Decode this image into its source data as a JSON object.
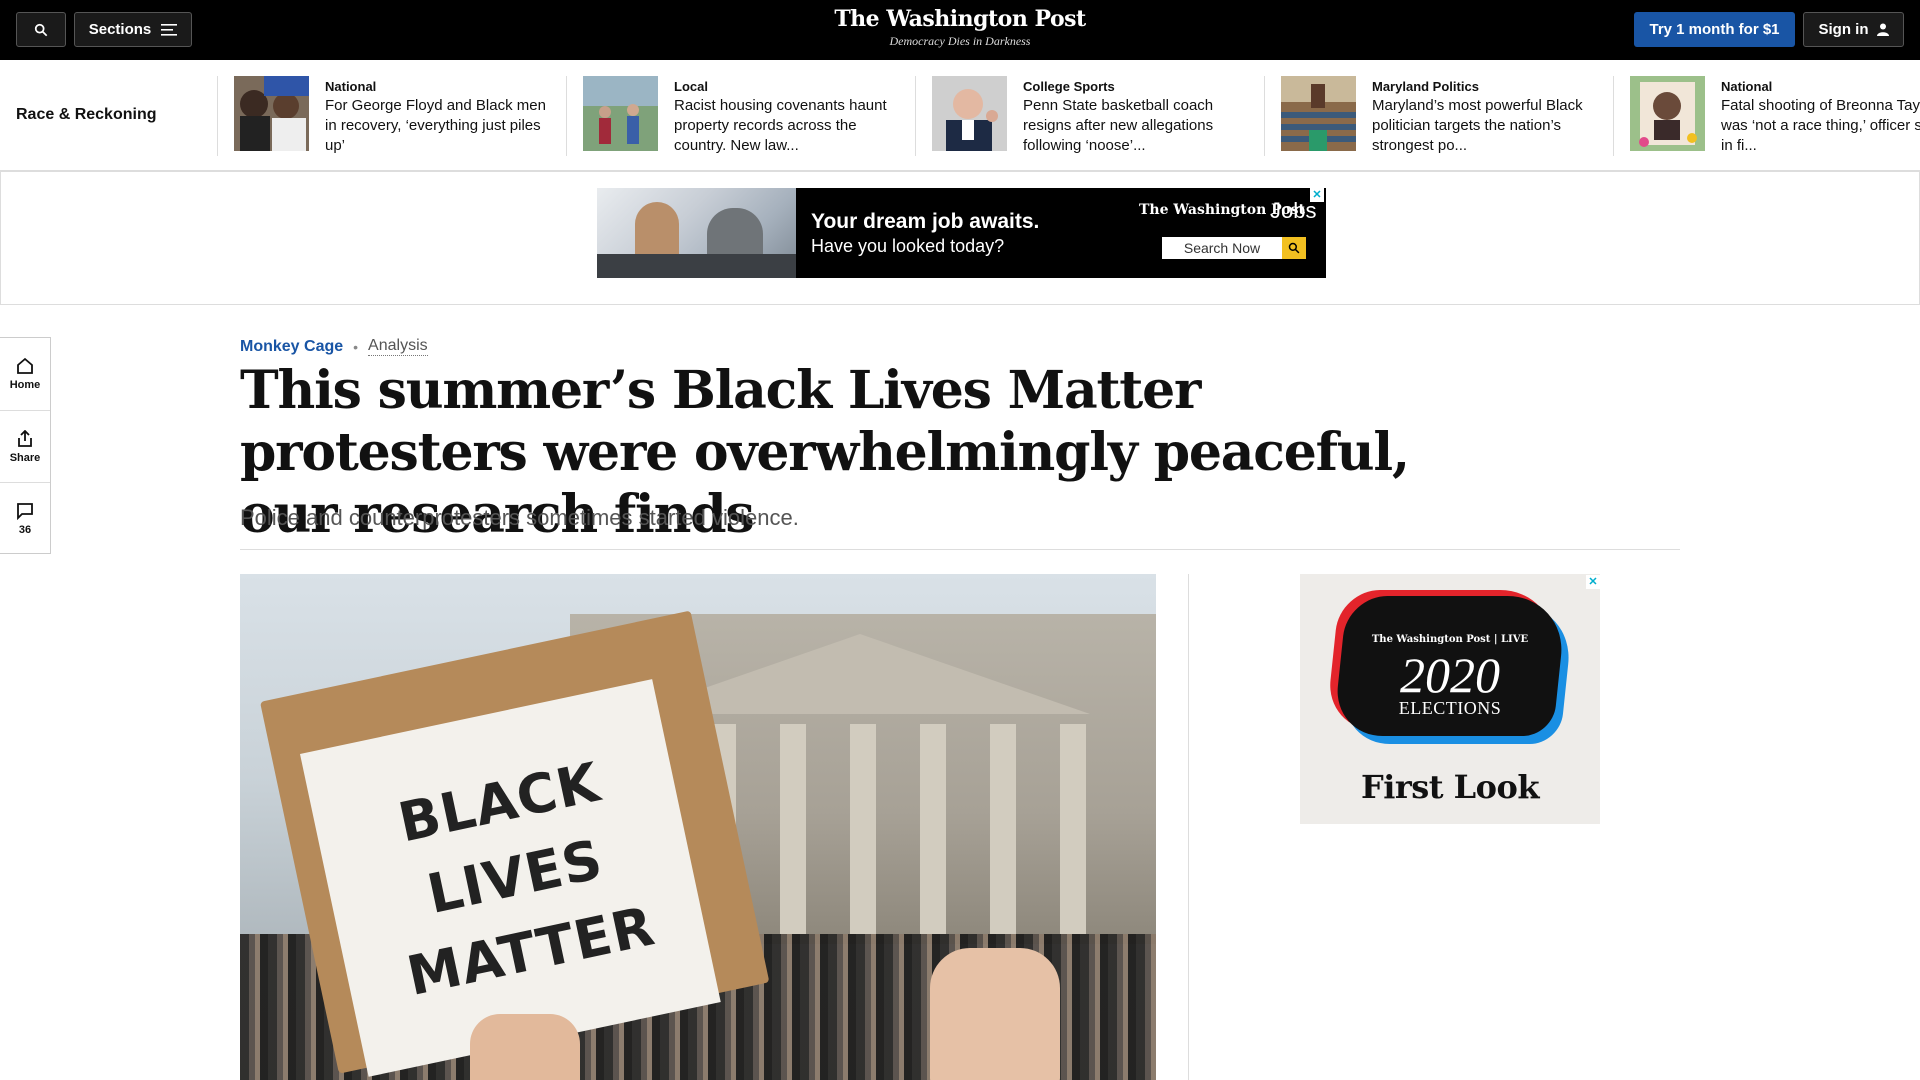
{
  "header": {
    "sections_label": "Sections",
    "logo": "The Washington Post",
    "tagline": "Democracy Dies in Darkness",
    "subscribe_label": "Try 1 month for $1",
    "signin_label": "Sign in",
    "icons": {
      "search": "search-icon",
      "menu": "menu-icon",
      "user": "user-icon"
    },
    "subscribe_color": "#1955a5"
  },
  "strip": {
    "title": "Race & Reckoning",
    "cards": [
      {
        "kicker": "National",
        "headline": "For George Floyd and Black men in recovery, ‘everything just piles up’"
      },
      {
        "kicker": "Local",
        "headline": "Racist housing covenants haunt property records across the country. New law..."
      },
      {
        "kicker": "College Sports",
        "headline": "Penn State basketball coach resigns after new allegations following ‘noose’..."
      },
      {
        "kicker": "Maryland Politics",
        "headline": "Maryland’s most powerful Black politician targets the nation’s strongest po..."
      },
      {
        "kicker": "National",
        "headline": "Fatal shooting of Breonna Taylor was ‘not a race thing,’ officer says in fi..."
      }
    ]
  },
  "ad_banner": {
    "line1": "Your dream job awaits.",
    "line2": "Have you looked today?",
    "brand": "The Washington Post",
    "brand_suffix": "Jobs",
    "search_label": "Search Now",
    "close": "✕"
  },
  "left_rail": {
    "home_label": "Home",
    "share_label": "Share",
    "comments_count": "36"
  },
  "article": {
    "section": "Monkey Cage",
    "label": "Analysis",
    "headline": "This summer’s Black Lives Matter protesters were overwhelmingly peaceful, our research finds",
    "subhead": "Police and counterprotesters sometimes started violence.",
    "sign_lines": [
      "BLACK",
      "LIVES",
      "MATTER"
    ]
  },
  "ad_square": {
    "brand": "The Washington Post | LIVE",
    "year": "2020",
    "title": "ELECTIONS",
    "tagline": "First Look",
    "close": "✕"
  }
}
